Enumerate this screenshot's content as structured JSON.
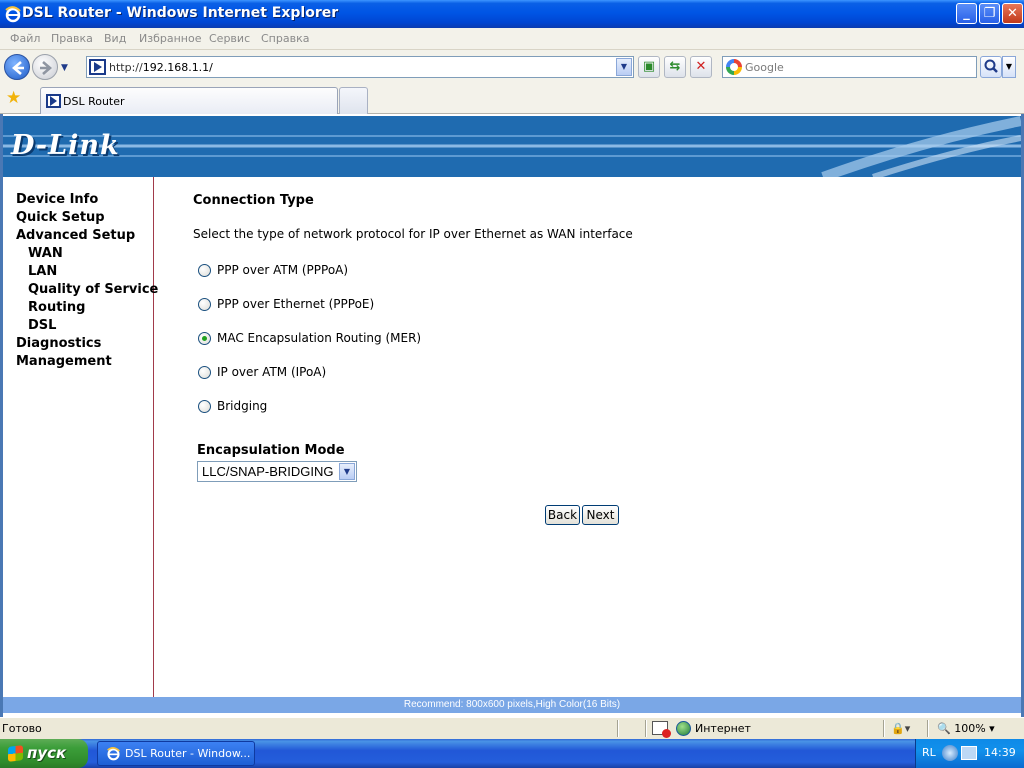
{
  "window": {
    "title": "DSL Router - Windows Internet Explorer",
    "minimize_label": "_",
    "maximize_label": "❐",
    "close_label": "✕"
  },
  "menu": [
    "Файл",
    "Правка",
    "Вид",
    "Избранное",
    "Сервис",
    "Справка"
  ],
  "address": {
    "prefix": "http://",
    "host": "192.168.1.1/"
  },
  "search": {
    "placeholder": "Google"
  },
  "tab": {
    "label": "DSL Router"
  },
  "router": {
    "logo": "D-Link",
    "sidebar": [
      {
        "label": "Device Info",
        "sub": false
      },
      {
        "label": "Quick Setup",
        "sub": false
      },
      {
        "label": "Advanced Setup",
        "sub": false
      },
      {
        "label": "WAN",
        "sub": true
      },
      {
        "label": "LAN",
        "sub": true
      },
      {
        "label": "Quality of Service",
        "sub": true
      },
      {
        "label": "Routing",
        "sub": true
      },
      {
        "label": "DSL",
        "sub": true
      },
      {
        "label": "Diagnostics",
        "sub": false
      },
      {
        "label": "Management",
        "sub": false
      }
    ],
    "title": "Connection Type",
    "description": "Select the type of network protocol for IP over Ethernet as WAN interface",
    "options": [
      {
        "label": "PPP over ATM (PPPoA)",
        "checked": false
      },
      {
        "label": "PPP over Ethernet (PPPoE)",
        "checked": false
      },
      {
        "label": "MAC Encapsulation Routing (MER)",
        "checked": true
      },
      {
        "label": "IP over ATM (IPoA)",
        "checked": false
      },
      {
        "label": "Bridging",
        "checked": false
      }
    ],
    "encap_label": "Encapsulation Mode",
    "encap_value": "LLC/SNAP-BRIDGING",
    "back_label": "Back",
    "next_label": "Next",
    "recommend": "Recommend: 800x600 pixels,High Color(16 Bits)"
  },
  "status": {
    "text": "Готово",
    "zone": "Интернет",
    "zoom": "100%"
  },
  "taskbar": {
    "start": "пуск",
    "task": "DSL Router - Window...",
    "lang": "RL",
    "clock": "14:39"
  },
  "colors": {
    "banner": "#1f6bb0",
    "sidebar_border": "#a13a4a",
    "recommend_bar": "#7aa7e6",
    "radio_dot": "#21a121"
  }
}
